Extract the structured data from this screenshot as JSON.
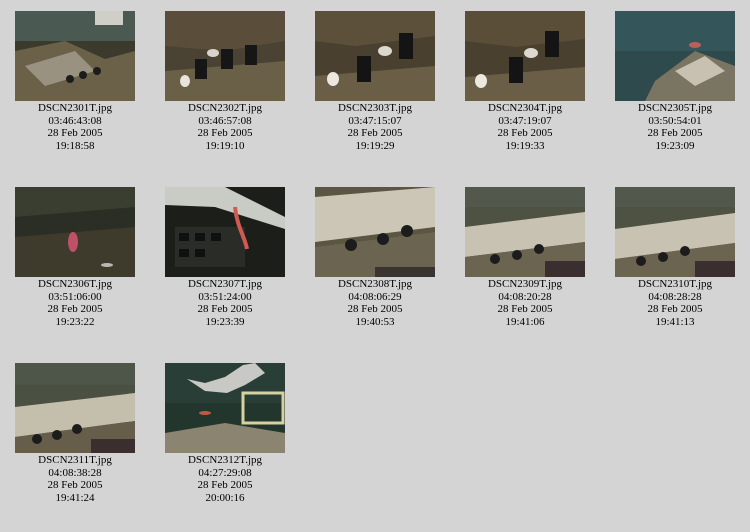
{
  "gallery": {
    "items": [
      {
        "file": "DSCN2301T.jpg",
        "time": "03:46:43:08",
        "date": "28 Feb 2005",
        "clock": "19:18:58"
      },
      {
        "file": "DSCN2302T.jpg",
        "time": "03:46:57:08",
        "date": "28 Feb 2005",
        "clock": "19:19:10"
      },
      {
        "file": "DSCN2303T.jpg",
        "time": "03:47:15:07",
        "date": "28 Feb 2005",
        "clock": "19:19:29"
      },
      {
        "file": "DSCN2304T.jpg",
        "time": "03:47:19:07",
        "date": "28 Feb 2005",
        "clock": "19:19:33"
      },
      {
        "file": "DSCN2305T.jpg",
        "time": "03:50:54:01",
        "date": "28 Feb 2005",
        "clock": "19:23:09"
      },
      {
        "file": "DSCN2306T.jpg",
        "time": "03:51:06:00",
        "date": "28 Feb 2005",
        "clock": "19:23:22"
      },
      {
        "file": "DSCN2307T.jpg",
        "time": "03:51:24:00",
        "date": "28 Feb 2005",
        "clock": "19:23:39"
      },
      {
        "file": "DSCN2308T.jpg",
        "time": "04:08:06:29",
        "date": "28 Feb 2005",
        "clock": "19:40:53"
      },
      {
        "file": "DSCN2309T.jpg",
        "time": "04:08:20:28",
        "date": "28 Feb 2005",
        "clock": "19:41:06"
      },
      {
        "file": "DSCN2310T.jpg",
        "time": "04:08:28:28",
        "date": "28 Feb 2005",
        "clock": "19:41:13"
      },
      {
        "file": "DSCN2311T.jpg",
        "time": "04:08:38:28",
        "date": "28 Feb 2005",
        "clock": "19:41:24"
      },
      {
        "file": "DSCN2312T.jpg",
        "time": "04:27:29:08",
        "date": "28 Feb 2005",
        "clock": "20:00:16"
      }
    ]
  }
}
